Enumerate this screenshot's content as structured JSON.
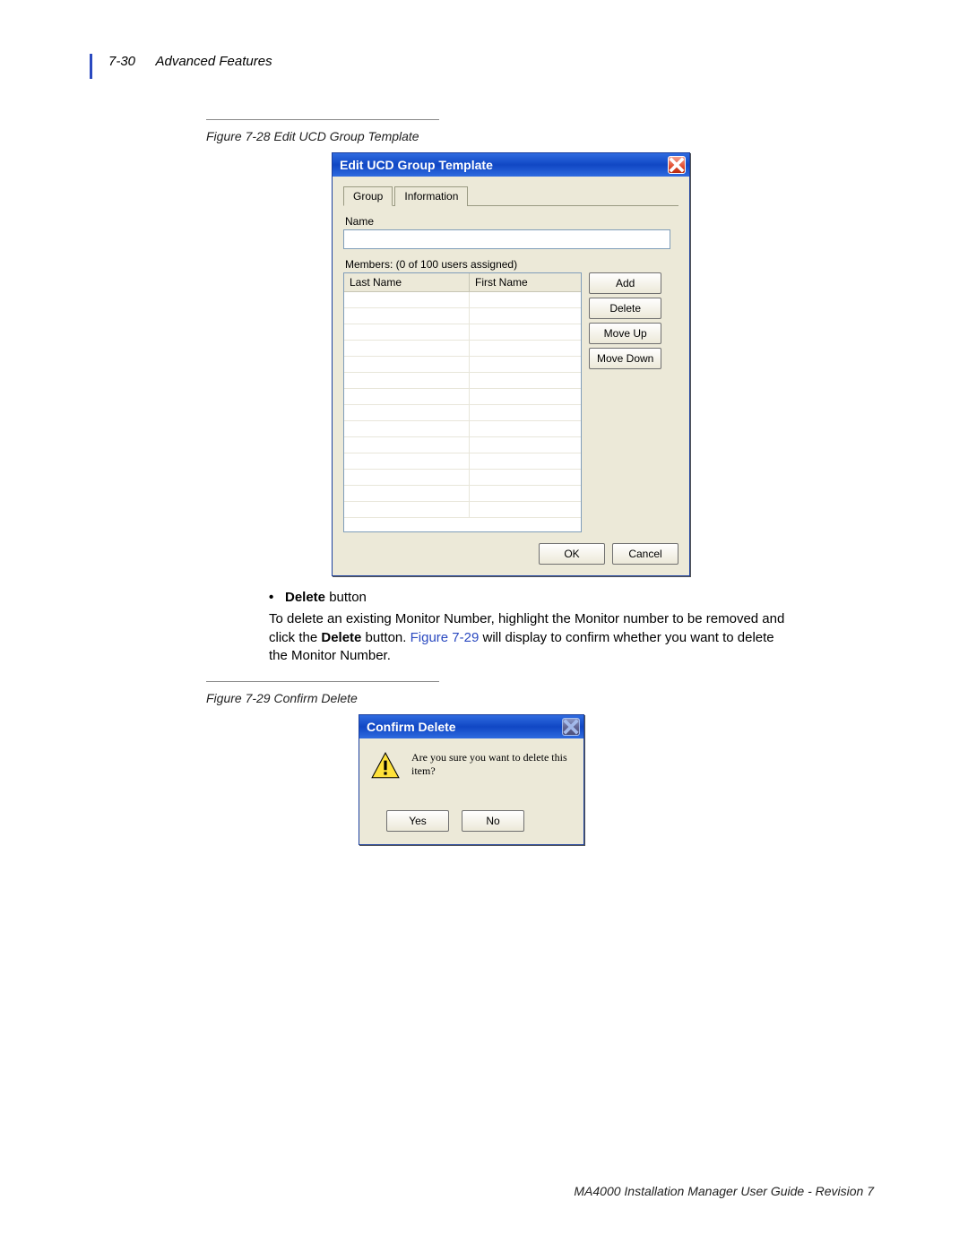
{
  "header": {
    "page_number": "7-30",
    "section": "Advanced Features"
  },
  "figure28": {
    "caption": "Figure 7-28  Edit UCD Group Template",
    "dialog": {
      "title": "Edit UCD Group Template",
      "tabs": [
        "Group",
        "Information"
      ],
      "name_label": "Name",
      "name_value": "",
      "members_label": "Members: (0 of 100 users assigned)",
      "columns": [
        "Last Name",
        "First Name"
      ],
      "rows": [
        [
          "",
          ""
        ],
        [
          "",
          ""
        ],
        [
          "",
          ""
        ],
        [
          "",
          ""
        ],
        [
          "",
          ""
        ],
        [
          "",
          ""
        ],
        [
          "",
          ""
        ],
        [
          "",
          ""
        ],
        [
          "",
          ""
        ],
        [
          "",
          ""
        ],
        [
          "",
          ""
        ],
        [
          "",
          ""
        ],
        [
          "",
          ""
        ],
        [
          "",
          ""
        ]
      ],
      "side_buttons": [
        "Add",
        "Delete",
        "Move Up",
        "Move Down"
      ],
      "buttons": [
        "OK",
        "Cancel"
      ]
    }
  },
  "body": {
    "bullet_bold": "Delete",
    "bullet_rest": " button",
    "para_1": "To delete an existing Monitor Number, highlight the Monitor number to be removed and click the ",
    "para_bold": "Delete",
    "para_2": " button. ",
    "para_link": "Figure 7-29",
    "para_3": " will display to confirm whether you want to delete the Monitor Number."
  },
  "figure29": {
    "caption": "Figure 7-29  Confirm Delete",
    "dialog": {
      "title": "Confirm Delete",
      "message": "Are you sure you want to delete this item?",
      "buttons": [
        "Yes",
        "No"
      ]
    }
  },
  "footer": "MA4000 Installation Manager User Guide - Revision 7"
}
